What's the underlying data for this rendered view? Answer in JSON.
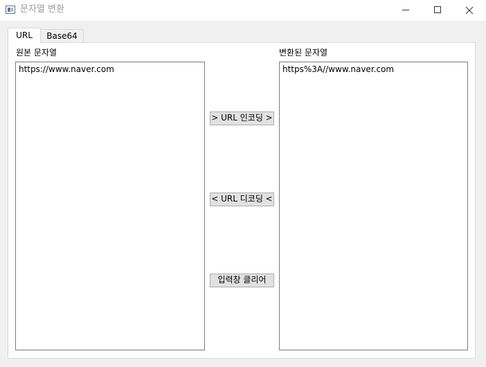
{
  "window": {
    "title": "문자열 변환",
    "icon": "window-app-icon"
  },
  "tabs": [
    {
      "label": "URL",
      "selected": true
    },
    {
      "label": "Base64",
      "selected": false
    }
  ],
  "source": {
    "label": "원본 문자열",
    "value": "https://www.naver.com"
  },
  "result": {
    "label": "변환된 문자열",
    "value": "https%3A//www.naver.com"
  },
  "actions": {
    "encode_label": "> URL 인코딩 >",
    "decode_label": "< URL 디코딩 <",
    "clear_label": "입력창 클리어"
  }
}
